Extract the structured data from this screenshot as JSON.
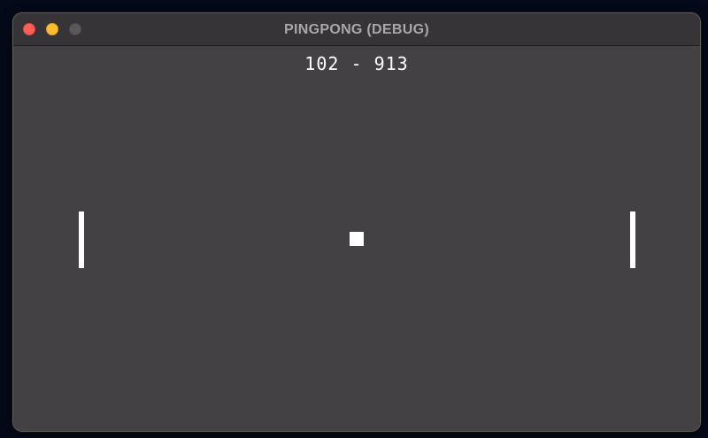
{
  "window": {
    "title": "PINGPONG (DEBUG)",
    "controls": [
      "close",
      "minimize",
      "zoom"
    ]
  },
  "game": {
    "score": {
      "left": "102",
      "separator": "-",
      "right": "913"
    }
  },
  "colors": {
    "background": "#434143",
    "titlebar": "#363436",
    "foreground": "#ffffff",
    "close": "#fe5f57",
    "minimize": "#febc2e",
    "zoom": "#5a585a"
  }
}
